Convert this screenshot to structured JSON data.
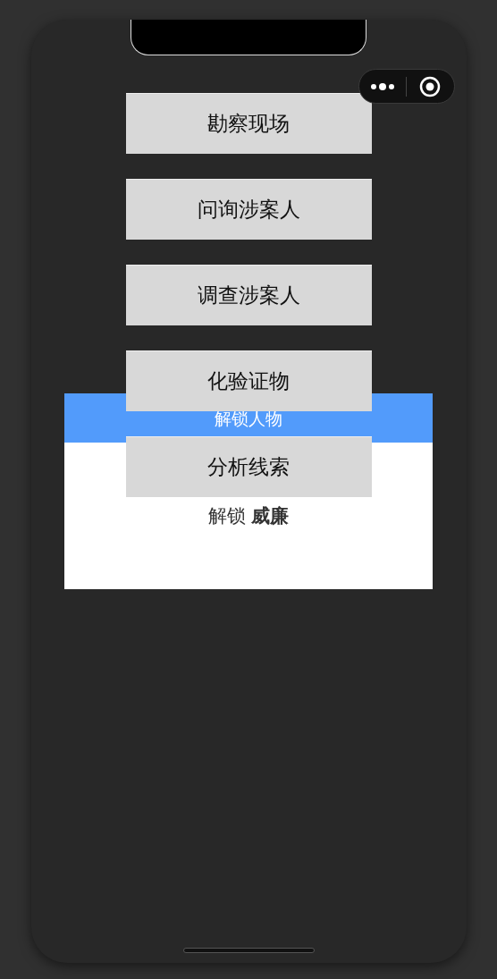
{
  "menu_buttons": [
    {
      "label": "勘察现场"
    },
    {
      "label": "问询涉案人"
    },
    {
      "label": "调查涉案人"
    },
    {
      "label": "化验证物"
    },
    {
      "label": "分析线索"
    }
  ],
  "dialog": {
    "title": "解锁人物",
    "message": "解锁 **威廉**"
  }
}
